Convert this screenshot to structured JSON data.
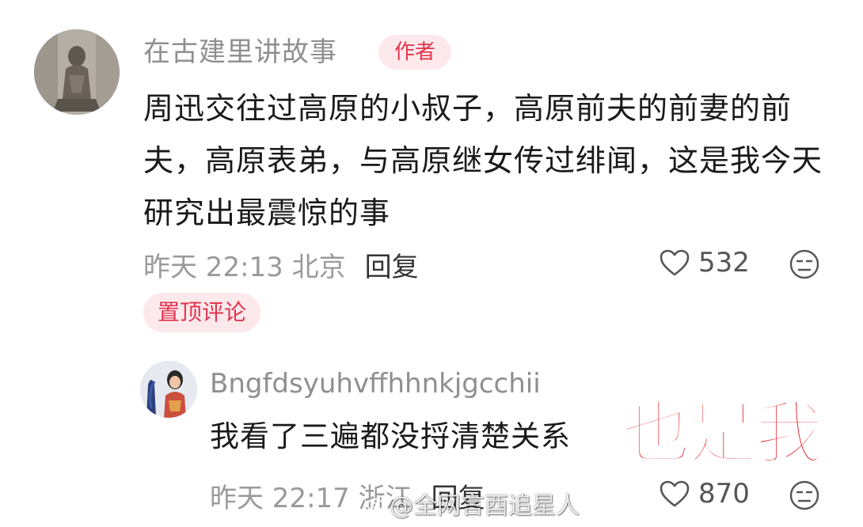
{
  "main_comment": {
    "author_name": "在古建里讲故事",
    "author_badge": "作者",
    "text": "周迅交往过高原的小叔子，高原前夫的前妻的前夫，高原表弟，与高原继女传过绯闻，这是我今天研究出最震惊的事",
    "meta": "昨天 22:13 北京",
    "reply_label": "回复",
    "like_count": "532",
    "pinned_label": "置顶评论"
  },
  "reply_comment": {
    "author_name": "Bngfdsyuhvffhhnkjgcchii",
    "text": "我看了三遍都没捋清楚关系",
    "meta": "昨天 22:17 浙江",
    "reply_label": "回复",
    "like_count": "870"
  },
  "overlay_caption": "也是我",
  "watermark": "@全网言酉追星人",
  "icons": {
    "like": "heart-outline-icon",
    "reaction": "neutral-face-icon",
    "watermark": "weibo-icon"
  },
  "colors": {
    "badge_bg": "#fde9ec",
    "badge_text": "#e2344f",
    "caption": "#e8141c"
  }
}
